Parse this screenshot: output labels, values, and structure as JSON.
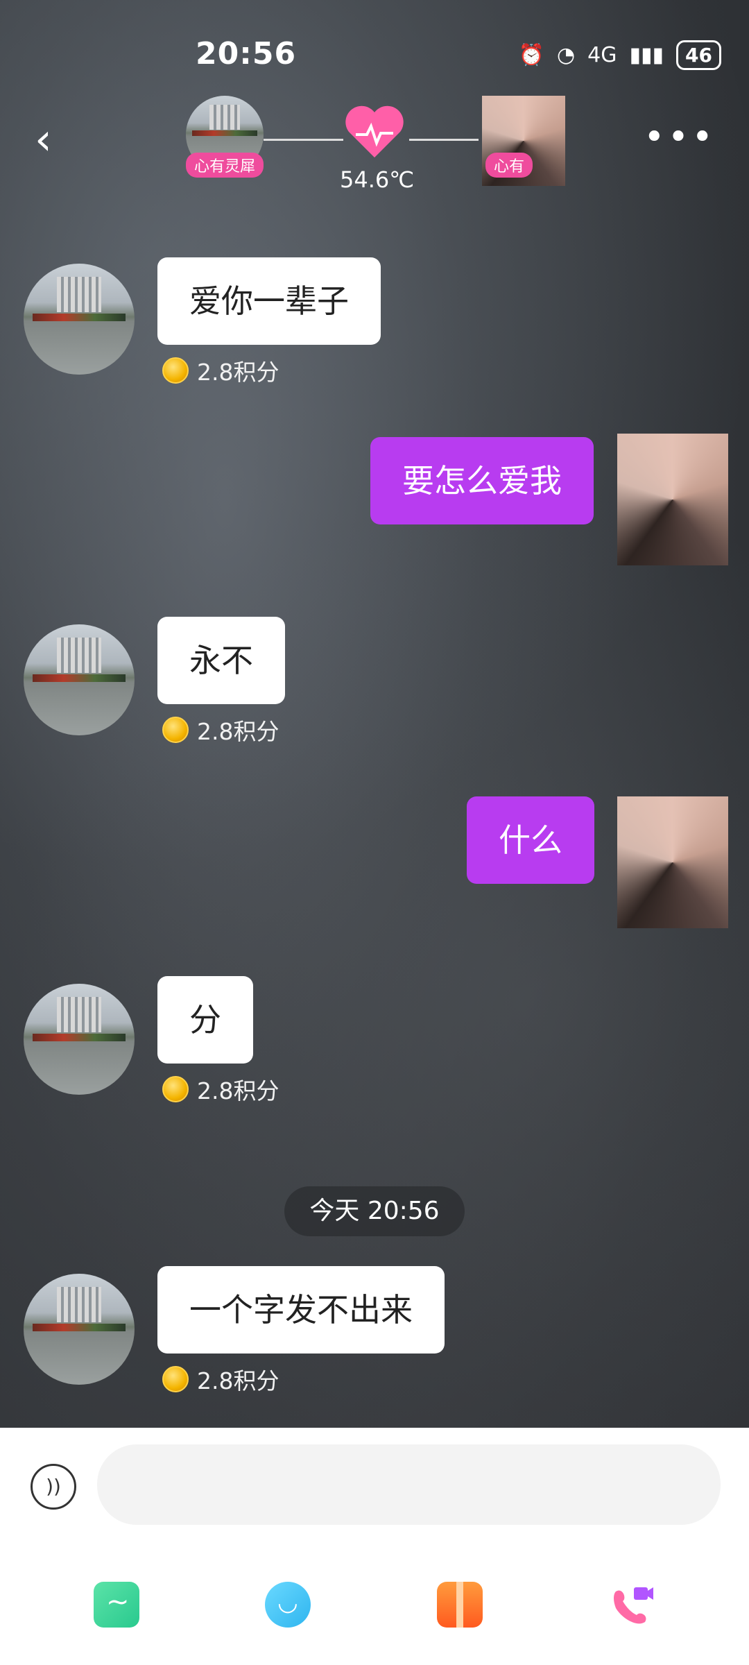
{
  "status_bar": {
    "time": "20:56",
    "network": "4G",
    "battery": "46"
  },
  "header": {
    "back_icon": "chevron-left-icon",
    "more_icon": "more-horizontal-icon",
    "left_tag": "心有灵犀",
    "right_tag": "心有",
    "temperature": "54.6℃"
  },
  "messages": [
    {
      "side": "in",
      "text": "爱你一辈子",
      "points": "2.8积分"
    },
    {
      "side": "out",
      "text": "要怎么爱我"
    },
    {
      "side": "in",
      "text": "永不",
      "points": "2.8积分"
    },
    {
      "side": "out",
      "text": "什么"
    },
    {
      "side": "in",
      "text": "分",
      "points": "2.8积分"
    },
    {
      "side": "in",
      "text": "一个字发不出来",
      "points": "2.8积分"
    }
  ],
  "timestamp": "今天 20:56",
  "input": {
    "placeholder": ""
  },
  "toolbar": [
    "image-icon",
    "emoji-icon",
    "gift-icon",
    "video-call-icon"
  ],
  "colors": {
    "outgoing_bubble": "#b83cf0",
    "tag_pink": "#ef4c9d"
  }
}
